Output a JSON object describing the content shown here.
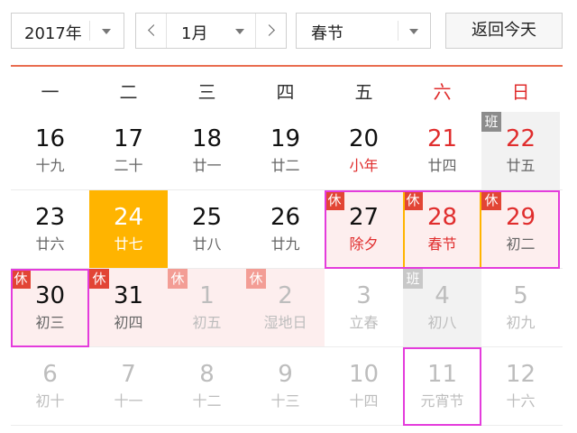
{
  "toolbar": {
    "year": "2017年",
    "month": "1月",
    "holiday": "春节",
    "today_label": "返回今天"
  },
  "weekdays": [
    "一",
    "二",
    "三",
    "四",
    "五",
    "六",
    "日"
  ],
  "tags": {
    "rest": "休",
    "work": "班"
  },
  "colors": {
    "accent_line": "#e96d50",
    "today_bg": "#ffb400",
    "rest_tag": "#e24535",
    "weekend_text": "#e02d2d",
    "highlight": "#e43cdc"
  },
  "weeks": [
    [
      {
        "d": "16",
        "l": "十九"
      },
      {
        "d": "17",
        "l": "二十"
      },
      {
        "d": "18",
        "l": "廿一"
      },
      {
        "d": "19",
        "l": "廿二"
      },
      {
        "d": "20",
        "l": "小年",
        "fest": true
      },
      {
        "d": "21",
        "l": "廿四",
        "we": true
      },
      {
        "d": "22",
        "l": "廿五",
        "we": true,
        "tag": "work"
      }
    ],
    [
      {
        "d": "23",
        "l": "廿六"
      },
      {
        "d": "24",
        "l": "廿七",
        "today": true
      },
      {
        "d": "25",
        "l": "廿八"
      },
      {
        "d": "26",
        "l": "廿九"
      },
      {
        "d": "27",
        "l": "除夕",
        "fest": true,
        "tag": "rest"
      },
      {
        "d": "28",
        "l": "春节",
        "fest": true,
        "we": true,
        "tag": "rest"
      },
      {
        "d": "29",
        "l": "初二",
        "we": true,
        "tag": "rest"
      }
    ],
    [
      {
        "d": "30",
        "l": "初三",
        "tag": "rest"
      },
      {
        "d": "31",
        "l": "初四",
        "tag": "rest"
      },
      {
        "d": "1",
        "l": "初五",
        "other": true,
        "tag": "rest"
      },
      {
        "d": "2",
        "l": "湿地日",
        "other": true,
        "tag": "rest"
      },
      {
        "d": "3",
        "l": "立春",
        "other": true
      },
      {
        "d": "4",
        "l": "初八",
        "other": true,
        "tag": "work"
      },
      {
        "d": "5",
        "l": "初九",
        "other": true
      }
    ],
    [
      {
        "d": "6",
        "l": "初十",
        "other": true
      },
      {
        "d": "7",
        "l": "十一",
        "other": true
      },
      {
        "d": "8",
        "l": "十二",
        "other": true
      },
      {
        "d": "9",
        "l": "十三",
        "other": true
      },
      {
        "d": "10",
        "l": "十四",
        "other": true
      },
      {
        "d": "11",
        "l": "元宵节",
        "other": true
      },
      {
        "d": "12",
        "l": "十六",
        "other": true
      }
    ]
  ]
}
